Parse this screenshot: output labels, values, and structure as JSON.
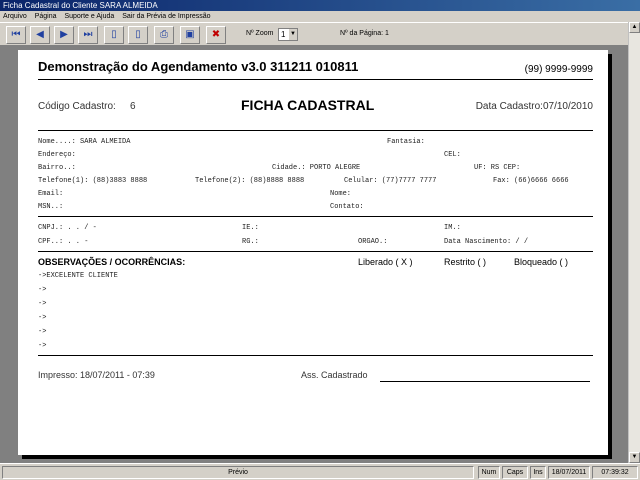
{
  "window": {
    "title": "Ficha Cadastral do Cliente SARA ALMEIDA"
  },
  "menu": [
    "Arquivo",
    "Página",
    "Suporte e Ajuda",
    "Sair da Prévia de Impressão"
  ],
  "toolbar": {
    "zoom_label": "Nº Zoom",
    "zoom_value": "1",
    "page_label": "Nº da Página: 1"
  },
  "report": {
    "title": "Demonstração do Agendamento v3.0 311211 010811",
    "phone": "(99) 9999-9999",
    "codigo_label": "Código Cadastro:",
    "codigo_value": "6",
    "ficha_title": "FICHA CADASTRAL",
    "data_cadastro": "Data Cadastro:07/10/2010",
    "fields": {
      "nome": "Nome....: SARA ALMEIDA",
      "fantasia": "Fantasia:",
      "endereco": "Endereço:",
      "cel": "CEL:",
      "bairro": "Bairro..:",
      "cidade": "Cidade.: PORTO ALEGRE",
      "uf": "UF: RS CEP:",
      "telefone1": "Telefone(1): (88)3883 8888",
      "telefone2": "Telefone(2): (88)8888 8888",
      "celular": "Celular: (77)7777 7777",
      "fax": "Fax: (66)6666 6666",
      "email": "Email:",
      "nome2": "Nome:",
      "msn": "MSN..:",
      "contato": "Contato:",
      "cnpj": "CNPJ.:     .    .    /     -",
      "ie": "IE.:",
      "im": "IM.:",
      "cpf": "CPF..:     .    .    -",
      "rg": "RG.:",
      "orgao": "ORGAO.:",
      "nascimento": "Data Nascimento:    /   /"
    },
    "obs_header": "OBSERVAÇÕES / OCORRÊNCIAS:",
    "status_options": [
      "Liberado ( X )",
      "Restrito (   )",
      "Bloqueado (   )"
    ],
    "obs_lines": [
      "->EXCELENTE CLIENTE",
      "->",
      "->",
      "->",
      "->",
      "->"
    ],
    "impresso": "Impresso: 18/07/2011 - 07:39",
    "ass_cadastrado": "Ass. Cadastrado"
  },
  "statusbar": {
    "mode": "Prévio",
    "num": "Num",
    "caps": "Caps",
    "ins": "Ins",
    "date": "18/07/2011",
    "time": "07:39:32"
  }
}
